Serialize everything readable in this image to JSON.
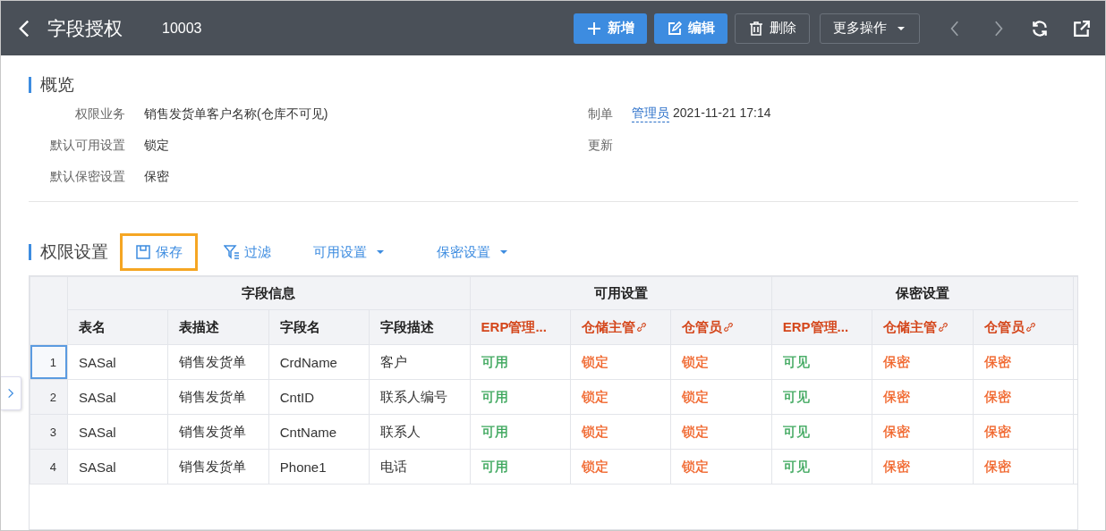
{
  "header": {
    "title": "字段授权",
    "record_no": "10003",
    "actions": [
      {
        "label": "新增",
        "kind": "primary"
      },
      {
        "label": "编辑",
        "kind": "primary"
      },
      {
        "label": "删除",
        "kind": "outline"
      },
      {
        "label": "更多操作",
        "kind": "dropdown"
      }
    ]
  },
  "overview": {
    "title": "概览",
    "fields": [
      {
        "label": "权限业务",
        "value": "销售发货单客户名称(仓库不可见)"
      },
      {
        "label": "制单",
        "link": "管理员",
        "value": "2021-11-21 17:14"
      },
      {
        "label": "默认可用设置",
        "value": "锁定"
      },
      {
        "label": "更新"
      },
      {
        "label": "默认保密设置",
        "value": "保密"
      }
    ]
  },
  "permissions": {
    "title": "权限设置",
    "toolbar": [
      {
        "label": "保存",
        "dropdown": false,
        "highlighted": true
      },
      {
        "label": "过滤",
        "dropdown": false,
        "highlighted": false
      },
      {
        "label": "可用设置",
        "dropdown": true,
        "highlighted": false
      },
      {
        "label": "保密设置",
        "dropdown": true,
        "highlighted": false
      }
    ],
    "table": {
      "groups": [
        {
          "label": "字段信息",
          "columns": [
            {
              "label": "表名",
              "emphasis": false,
              "link": false
            },
            {
              "label": "表描述",
              "emphasis": false,
              "link": false
            },
            {
              "label": "字段名",
              "emphasis": false,
              "link": false
            },
            {
              "label": "字段描述",
              "emphasis": false,
              "link": false
            }
          ]
        },
        {
          "label": "可用设置",
          "columns": [
            {
              "label": "ERP管理...",
              "emphasis": true,
              "link": false
            },
            {
              "label": "仓储主管",
              "emphasis": true,
              "link": true
            },
            {
              "label": "仓管员",
              "emphasis": true,
              "link": true
            }
          ]
        },
        {
          "label": "保密设置",
          "columns": [
            {
              "label": "ERP管理...",
              "emphasis": true,
              "link": false
            },
            {
              "label": "仓储主管",
              "emphasis": true,
              "link": true
            },
            {
              "label": "仓管员",
              "emphasis": true,
              "link": true
            }
          ]
        }
      ],
      "rows": [
        {
          "no": "1",
          "selected": true,
          "cells": [
            "SASal",
            "销售发货单",
            "CrdName",
            "客户",
            {
              "text": "可用",
              "color": "#3aa55a"
            },
            {
              "text": "锁定",
              "color": "#f0642a"
            },
            {
              "text": "锁定",
              "color": "#f0642a"
            },
            {
              "text": "可见",
              "color": "#3aa55a"
            },
            {
              "text": "保密",
              "color": "#f0642a"
            },
            {
              "text": "保密",
              "color": "#f0642a"
            }
          ]
        },
        {
          "no": "2",
          "selected": false,
          "cells": [
            "SASal",
            "销售发货单",
            "CntID",
            "联系人编号",
            {
              "text": "可用",
              "color": "#3aa55a"
            },
            {
              "text": "锁定",
              "color": "#f0642a"
            },
            {
              "text": "锁定",
              "color": "#f0642a"
            },
            {
              "text": "可见",
              "color": "#3aa55a"
            },
            {
              "text": "保密",
              "color": "#f0642a"
            },
            {
              "text": "保密",
              "color": "#f0642a"
            }
          ]
        },
        {
          "no": "3",
          "selected": false,
          "cells": [
            "SASal",
            "销售发货单",
            "CntName",
            "联系人",
            {
              "text": "可用",
              "color": "#3aa55a"
            },
            {
              "text": "锁定",
              "color": "#f0642a"
            },
            {
              "text": "锁定",
              "color": "#f0642a"
            },
            {
              "text": "可见",
              "color": "#3aa55a"
            },
            {
              "text": "保密",
              "color": "#f0642a"
            },
            {
              "text": "保密",
              "color": "#f0642a"
            }
          ]
        },
        {
          "no": "4",
          "selected": false,
          "cells": [
            "SASal",
            "销售发货单",
            "Phone1",
            "电话",
            {
              "text": "可用",
              "color": "#3aa55a"
            },
            {
              "text": "锁定",
              "color": "#f0642a"
            },
            {
              "text": "锁定",
              "color": "#f0642a"
            },
            {
              "text": "可见",
              "color": "#3aa55a"
            },
            {
              "text": "保密",
              "color": "#f0642a"
            },
            {
              "text": "保密",
              "color": "#f0642a"
            }
          ]
        }
      ]
    }
  }
}
